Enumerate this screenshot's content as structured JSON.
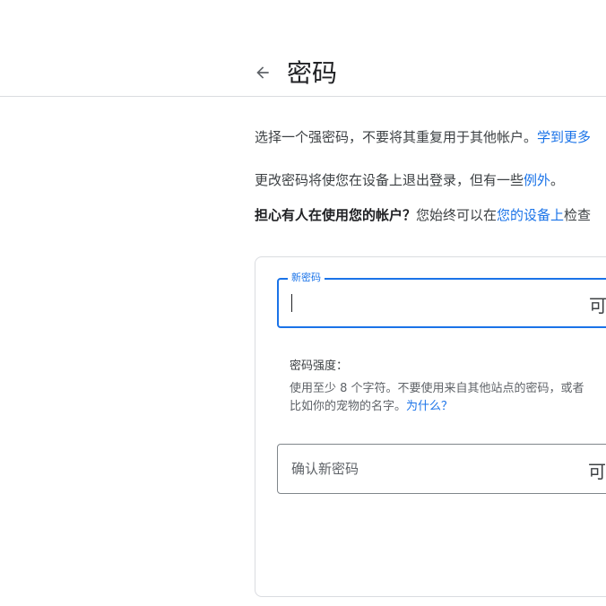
{
  "header": {
    "title": "密码",
    "back_icon": "arrow-left-icon"
  },
  "intro": {
    "line1_text": "选择一个强密码，不要将其重复用于其他帐户。",
    "line1_link": "学到更多",
    "line2_text": "更改密码将使您在设备上退出登录，但有一些",
    "line2_link": "例外",
    "line2_end": "。",
    "line3_bold": "担心有人在使用您的帐户？",
    "line3_text": "您始终可以在",
    "line3_link": "您的设备上",
    "line3_end": "检查"
  },
  "form": {
    "new_password_label": "新密码",
    "new_password_value": "",
    "visibility_toggle_text": "可",
    "strength_label": "密码强度：",
    "strength_hint_line1": "使用至少 8 个字符。不要使用来自其他站点的密码，或者",
    "strength_hint_line2": "比如你的宠物的名字。",
    "strength_hint_link": "为什么？",
    "confirm_password_placeholder": "确认新密码",
    "confirm_visibility_toggle_text": "可"
  },
  "colors": {
    "accent": "#1a73e8",
    "border": "#dadce0"
  }
}
